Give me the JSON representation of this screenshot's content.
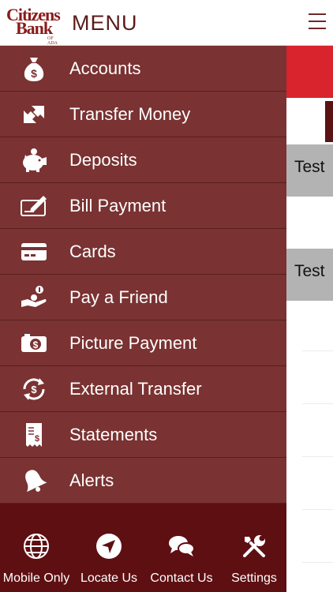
{
  "header": {
    "logo_line1": "Citizens",
    "logo_line2": "Bank",
    "logo_line3": "OF ADA",
    "title": "MENU",
    "menu_icon": "hamburger-icon"
  },
  "background": {
    "rows": [
      "Test",
      "Test"
    ]
  },
  "menu": {
    "items": [
      {
        "label": "Accounts",
        "icon": "money-bag-icon"
      },
      {
        "label": "Transfer Money",
        "icon": "transfer-arrows-icon"
      },
      {
        "label": "Deposits",
        "icon": "piggy-bank-icon"
      },
      {
        "label": "Bill Payment",
        "icon": "check-pen-icon"
      },
      {
        "label": "Cards",
        "icon": "credit-card-icon"
      },
      {
        "label": "Pay a Friend",
        "icon": "hand-coin-icon"
      },
      {
        "label": "Picture Payment",
        "icon": "camera-dollar-icon"
      },
      {
        "label": "External Transfer",
        "icon": "exchange-dollar-icon"
      },
      {
        "label": "Statements",
        "icon": "receipt-icon"
      },
      {
        "label": "Alerts",
        "icon": "bell-icon"
      }
    ]
  },
  "footer": {
    "buttons": [
      {
        "label": "Mobile Only",
        "icon": "globe-icon"
      },
      {
        "label": "Locate Us",
        "icon": "location-arrow-icon"
      },
      {
        "label": "Contact Us",
        "icon": "chat-bubbles-icon"
      },
      {
        "label": "Settings",
        "icon": "tools-icon"
      }
    ]
  },
  "colors": {
    "drawer": "#7a3232",
    "divider": "#5a1e1e",
    "footer": "#5e0f12",
    "brand": "#8b1a1a",
    "accent_red": "#d9232d"
  }
}
